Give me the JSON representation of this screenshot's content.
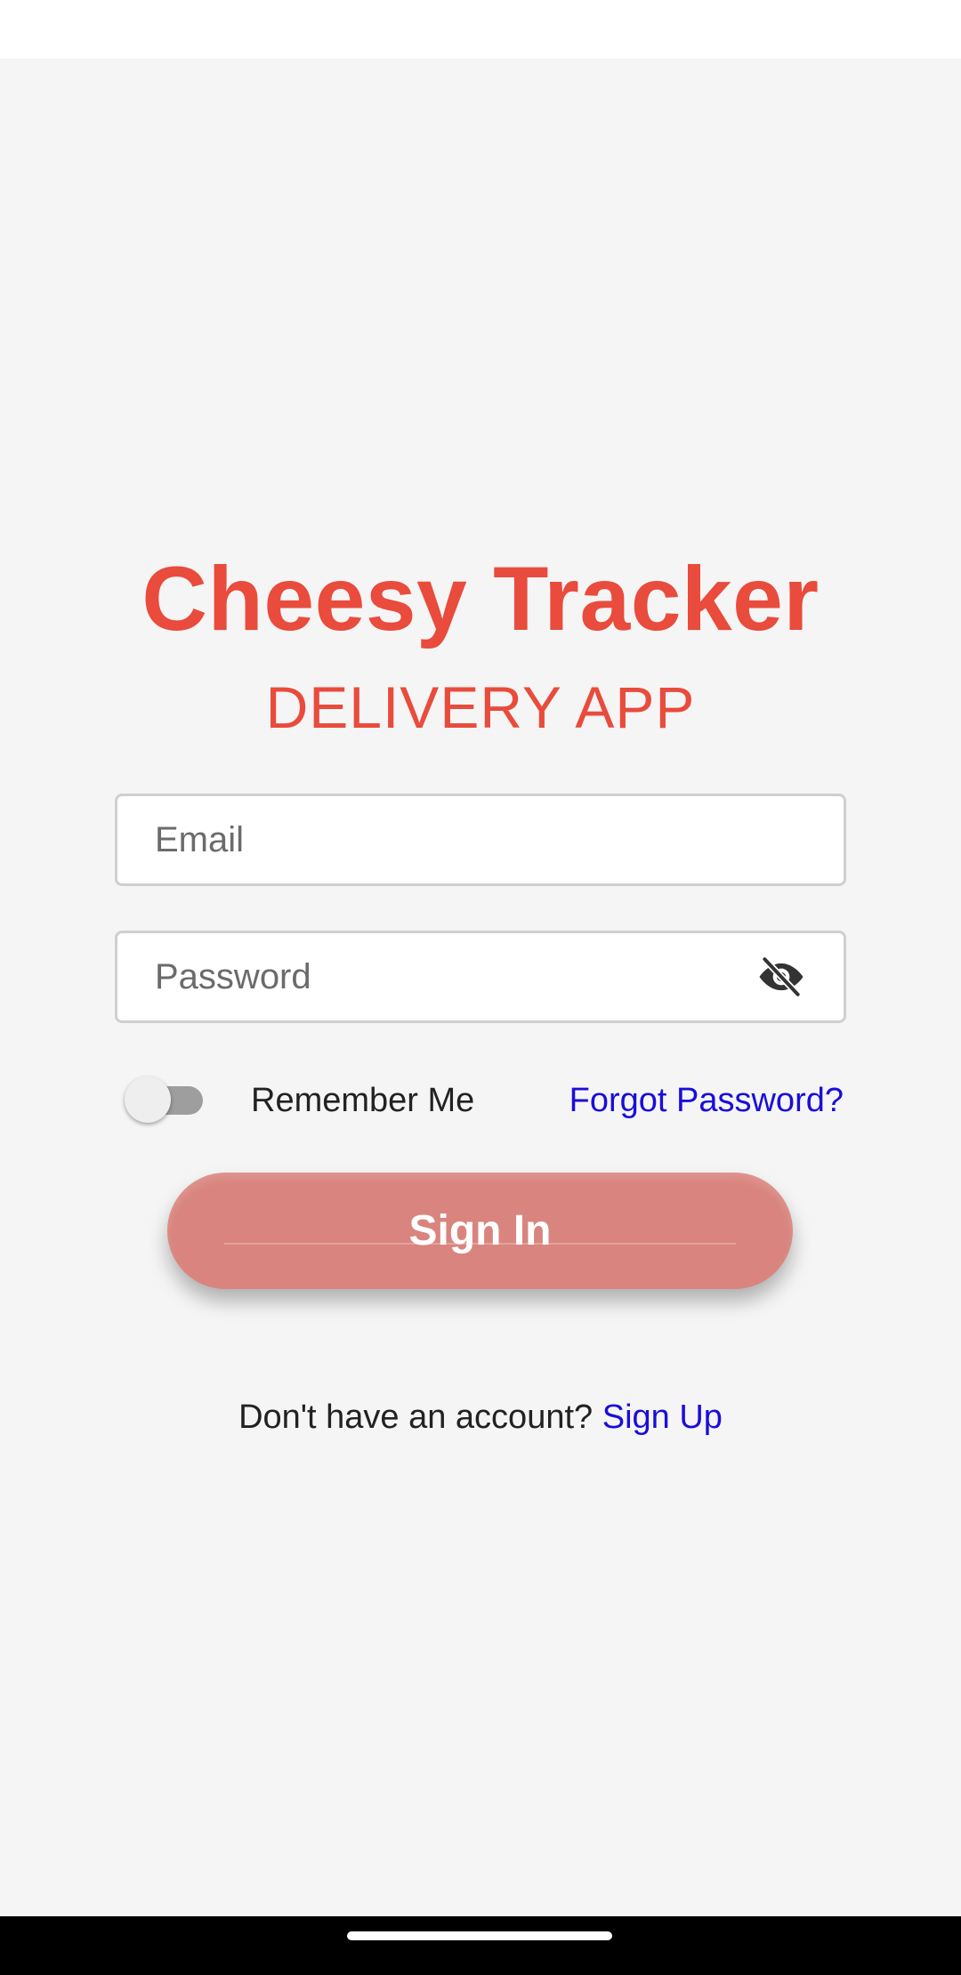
{
  "app": {
    "title": "Cheesy Tracker",
    "subtitle": "DELIVERY APP"
  },
  "form": {
    "email_placeholder": "Email",
    "password_placeholder": "Password",
    "password_toggle_icon": "eye-off-icon",
    "remember_me_label": "Remember Me",
    "remember_me_checked": false,
    "forgot_password_label": "Forgot Password?",
    "sign_in_label": "Sign In"
  },
  "footer": {
    "prompt_text": "Don't have an account?",
    "sign_up_label": "Sign Up"
  },
  "colors": {
    "brand": "#e94b3c",
    "link": "#1a0dda",
    "button": "#d9847e",
    "background": "#f5f5f5"
  }
}
